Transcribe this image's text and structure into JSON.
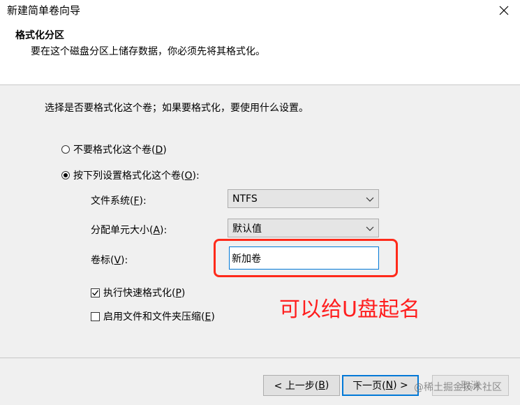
{
  "window": {
    "title": "新建简单卷向导"
  },
  "header": {
    "title": "格式化分区",
    "subtitle": "要在这个磁盘分区上储存数据，你必须先将其格式化。"
  },
  "prompt": "选择是否要格式化这个卷；如果要格式化，要使用什么设置。",
  "options": {
    "no_format": {
      "label": "不要格式化这个卷(",
      "key": "D",
      "suffix": ")",
      "checked": false
    },
    "format": {
      "label": "按下列设置格式化这个卷(",
      "key": "O",
      "suffix": "):",
      "checked": true
    }
  },
  "fields": {
    "filesystem": {
      "label": "文件系统(",
      "key": "F",
      "suffix": "):",
      "value": "NTFS"
    },
    "alloc_unit": {
      "label": "分配单元大小(",
      "key": "A",
      "suffix": "):",
      "value": "默认值"
    },
    "volume_label": {
      "label": "卷标(",
      "key": "V",
      "suffix": "):",
      "value": "新加卷"
    }
  },
  "checkboxes": {
    "quick_format": {
      "label": "执行快速格式化(",
      "key": "P",
      "suffix": ")",
      "checked": true
    },
    "compression": {
      "label": "启用文件和文件夹压缩(",
      "key": "E",
      "suffix": ")",
      "checked": false
    }
  },
  "annotation": {
    "text": "可以给U盘起名",
    "color": "#ff1e1e"
  },
  "buttons": {
    "back": {
      "label": "< 上一步(",
      "key": "B",
      "suffix": ")"
    },
    "next": {
      "label": "下一页(",
      "key": "N",
      "suffix": ") >"
    },
    "cancel": {
      "label": "取消"
    }
  },
  "watermark": "@稀土掘金技术社区",
  "colors": {
    "accent": "#0078d7",
    "highlight": "#ff2a1a"
  }
}
